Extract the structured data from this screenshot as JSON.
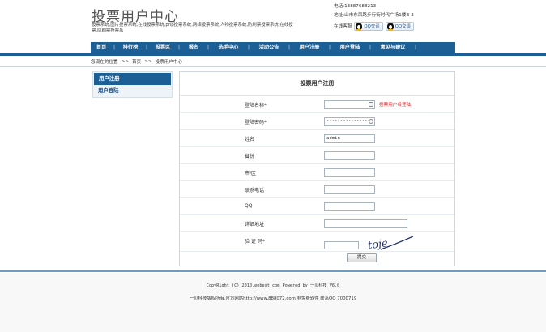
{
  "header": {
    "title": "投票用户中心",
    "description": "投票系统,图片投票系统,在线投票系统,php投票系统,网络投票系统,人物投票系统,防刷票投票系统,在线投票,防刷票投票系",
    "phone": "电话:13887688213",
    "address": "地址:山市东风路步行街时代广场1楼B-3",
    "online_label": "在线客服",
    "qq_buttons": [
      "QQ交谈",
      "QQ交谈"
    ]
  },
  "nav": {
    "items": [
      "首页",
      "排行榜",
      "投票区",
      "报名",
      "选手中心",
      "活动公告",
      "用户注册",
      "用户登陆",
      "意见与建议"
    ]
  },
  "breadcrumb": {
    "prefix": "您现在的位置",
    "items": [
      "首页",
      "投票用户中心"
    ],
    "separator": ">>"
  },
  "sidebar": {
    "items": [
      {
        "label": "用户注册",
        "active": true
      },
      {
        "label": "用户登陆",
        "active": false
      }
    ]
  },
  "form": {
    "title": "投票用户注册",
    "fields": {
      "username": {
        "label": "登陆名称*",
        "value": "",
        "hint": "投票用户名登陆"
      },
      "password": {
        "label": "登陆密码*",
        "value": "••••••••••••••••"
      },
      "name": {
        "label": "姓名",
        "value": "admin"
      },
      "province": {
        "label": "省份",
        "value": ""
      },
      "city": {
        "label": "市/区",
        "value": ""
      },
      "phone": {
        "label": "联系电话",
        "value": ""
      },
      "qq": {
        "label": "QQ",
        "value": ""
      },
      "address": {
        "label": "详细地址",
        "value": ""
      },
      "captcha": {
        "label": "验 证 码*",
        "value": "",
        "image_text": "toje"
      }
    },
    "submit_label": "提交"
  },
  "footer": {
    "copyright": "CopyRight (C) 2010.eebest.com Powered by 一贝科技 V6.0",
    "info": "一贝科技版权所有,官方网站http://www.888072.com 非免费软件 联系QQ 7000719"
  },
  "colors": {
    "nav_bg": "#1c5f95",
    "hint_red": "#e02020",
    "footer_line": "#6e9cc0"
  }
}
